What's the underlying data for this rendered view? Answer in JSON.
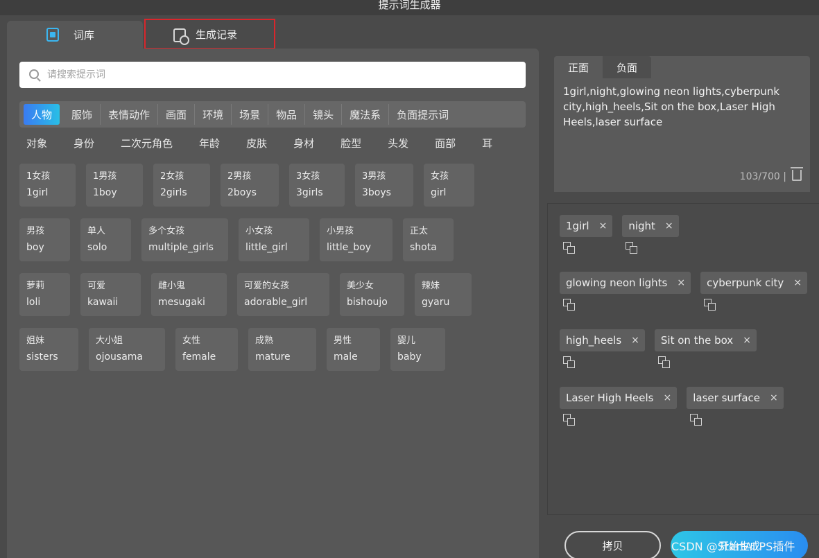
{
  "window": {
    "title": "提示词生成器"
  },
  "main_tabs": {
    "library": "词库",
    "history": "生成记录"
  },
  "search": {
    "placeholder": "请搜索提示词"
  },
  "categories": [
    "人物",
    "服饰",
    "表情动作",
    "画面",
    "环境",
    "场景",
    "物品",
    "镜头",
    "魔法系",
    "负面提示词"
  ],
  "subcategories": [
    "对象",
    "身份",
    "二次元角色",
    "年龄",
    "皮肤",
    "身材",
    "脸型",
    "头发",
    "面部",
    "耳"
  ],
  "cards": [
    [
      {
        "zh": "1女孩",
        "en": "1girl"
      },
      {
        "zh": "1男孩",
        "en": "1boy"
      },
      {
        "zh": "2女孩",
        "en": "2girls"
      },
      {
        "zh": "2男孩",
        "en": "2boys"
      },
      {
        "zh": "3女孩",
        "en": "3girls"
      },
      {
        "zh": "3男孩",
        "en": "3boys"
      },
      {
        "zh": "女孩",
        "en": "girl"
      }
    ],
    [
      {
        "zh": "男孩",
        "en": "boy"
      },
      {
        "zh": "单人",
        "en": "solo"
      },
      {
        "zh": "多个女孩",
        "en": "multiple_girls"
      },
      {
        "zh": "小女孩",
        "en": "little_girl"
      },
      {
        "zh": "小男孩",
        "en": "little_boy"
      },
      {
        "zh": "正太",
        "en": "shota"
      }
    ],
    [
      {
        "zh": "萝莉",
        "en": "loli"
      },
      {
        "zh": "可爱",
        "en": "kawaii"
      },
      {
        "zh": "雌小鬼",
        "en": "mesugaki"
      },
      {
        "zh": "可爱的女孩",
        "en": "adorable_girl"
      },
      {
        "zh": "美少女",
        "en": "bishoujo"
      },
      {
        "zh": "辣妹",
        "en": "gyaru"
      }
    ],
    [
      {
        "zh": "姐妹",
        "en": "sisters"
      },
      {
        "zh": "大小姐",
        "en": "ojousama"
      },
      {
        "zh": "女性",
        "en": "female"
      },
      {
        "zh": "成熟",
        "en": "mature"
      },
      {
        "zh": "男性",
        "en": "male"
      },
      {
        "zh": "婴儿",
        "en": "baby"
      }
    ]
  ],
  "editor": {
    "tab_positive": "正面",
    "tab_negative": "负面",
    "text": "1girl,night,glowing neon lights,cyberpunk city,high_heels,Sit on the box,Laser High Heels,laser surface",
    "count": "103/700 |"
  },
  "tags": [
    [
      "1girl",
      "night"
    ],
    [
      "glowing neon lights",
      "cyberpunk city"
    ],
    [
      "high_heels",
      "Sit on the box"
    ],
    [
      "Laser High Heels",
      "laser surface"
    ]
  ],
  "tag_remove_glyph": "×",
  "buttons": {
    "copy": "拷贝",
    "start": "开始生成"
  },
  "watermark": "CSDN @StartAI PS插件",
  "colors": {
    "accent": "#2ab6e8",
    "highlight_border": "#d9262c"
  }
}
